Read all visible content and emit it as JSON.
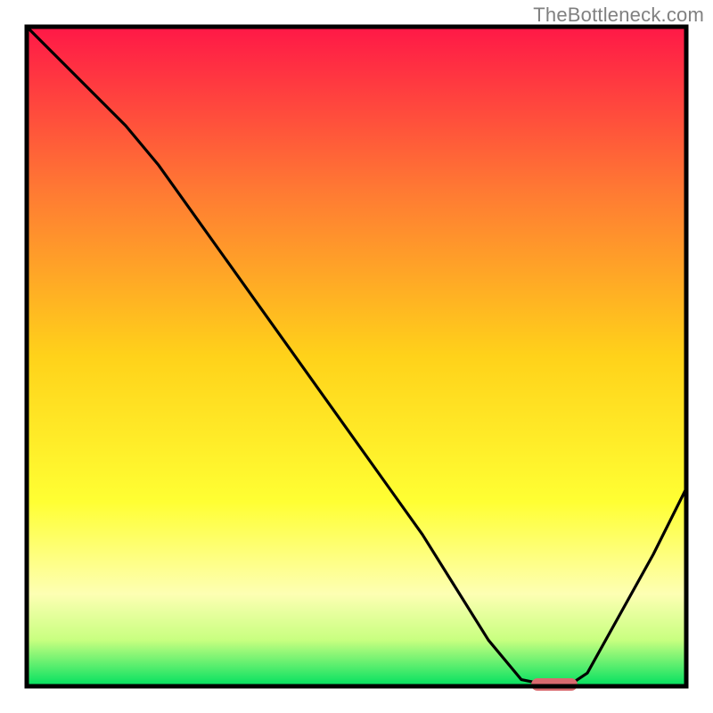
{
  "watermark": "TheBottleneck.com",
  "chart_data": {
    "type": "line",
    "title": "",
    "xlabel": "",
    "ylabel": "",
    "xlim": [
      0,
      100
    ],
    "ylim": [
      0,
      100
    ],
    "x": [
      0,
      5,
      10,
      15,
      20,
      25,
      30,
      35,
      40,
      45,
      50,
      55,
      60,
      65,
      70,
      75,
      80,
      82,
      85,
      90,
      95,
      100
    ],
    "values": [
      100,
      95,
      90,
      85,
      79,
      72,
      65,
      58,
      51,
      44,
      37,
      30,
      23,
      15,
      7,
      1,
      0,
      0,
      2,
      11,
      20,
      30
    ],
    "marker": {
      "x_center": 80,
      "width": 7,
      "y": 0
    },
    "gradient_stops": [
      {
        "pos": 0.0,
        "color": "#ff1847"
      },
      {
        "pos": 0.25,
        "color": "#ff7a33"
      },
      {
        "pos": 0.5,
        "color": "#ffd21a"
      },
      {
        "pos": 0.72,
        "color": "#ffff33"
      },
      {
        "pos": 0.86,
        "color": "#fdffb3"
      },
      {
        "pos": 0.93,
        "color": "#c8ff80"
      },
      {
        "pos": 1.0,
        "color": "#00e060"
      }
    ],
    "marker_color": "#d96a6f",
    "curve_color": "#000000",
    "axis_color": "#000000"
  }
}
